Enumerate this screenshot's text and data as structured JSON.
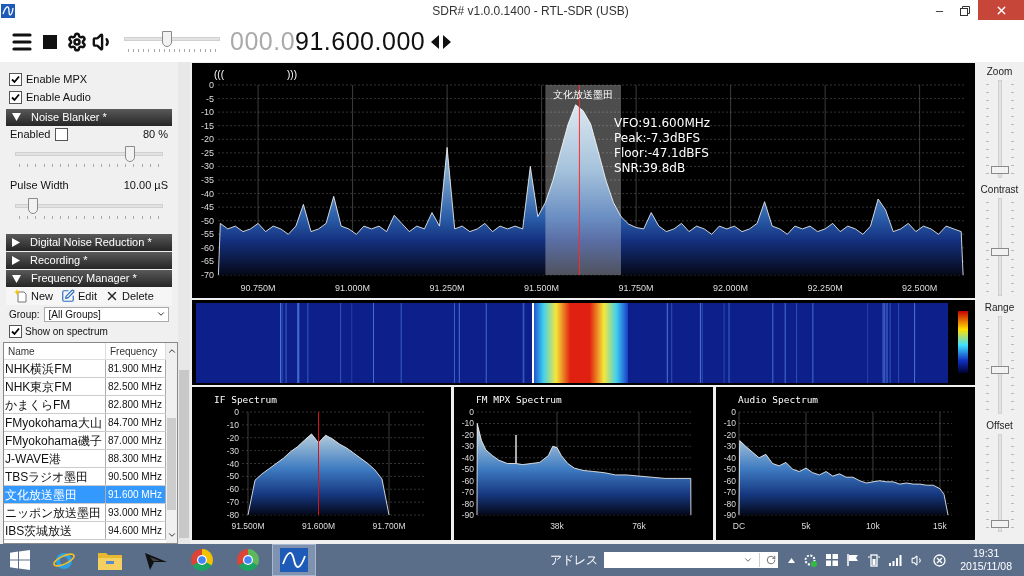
{
  "window": {
    "title": "SDR# v1.0.0.1400 - RTL-SDR (USB)"
  },
  "toolbar": {
    "volume": {
      "level": 0.45
    },
    "frequency": {
      "leading": "000.0",
      "value": "91.600.000"
    }
  },
  "left_panel": {
    "checkboxes": [
      {
        "label": "Enable MPX",
        "checked": true
      },
      {
        "label": "Enable Audio",
        "checked": true
      }
    ],
    "noise_blanker": {
      "header": "Noise Blanker *",
      "expanded": true,
      "enabled": {
        "label": "Enabled",
        "checked": false
      },
      "threshold": {
        "reading": "80 %",
        "level": 0.78
      },
      "pulse_width": {
        "label": "Pulse Width",
        "reading": "10.00 µS",
        "level": 0.12
      }
    },
    "sections": [
      {
        "header": "Digital Noise Reduction *",
        "expanded": false
      },
      {
        "header": "Recording *",
        "expanded": false
      }
    ],
    "frequency_manager": {
      "header": "Frequency Manager *",
      "expanded": true,
      "actions": [
        {
          "label": "New",
          "kind": "new"
        },
        {
          "label": "Edit",
          "kind": "edit"
        },
        {
          "label": "Delete",
          "kind": "delete"
        }
      ],
      "group": {
        "label": "Group:",
        "value": "[All Groups]"
      },
      "show_on_spectrum": {
        "label": "Show on spectrum",
        "checked": true
      },
      "table": {
        "columns": [
          "Name",
          "Frequency"
        ],
        "rows": [
          {
            "name": "NHK横浜FM",
            "frequency": "81.900 MHz",
            "selected": false
          },
          {
            "name": "NHK東京FM",
            "frequency": "82.500 MHz",
            "selected": false
          },
          {
            "name": "かまくらFM",
            "frequency": "82.800 MHz",
            "selected": false
          },
          {
            "name": "FMyokohama大山",
            "frequency": "84.700 MHz",
            "selected": false
          },
          {
            "name": "FMyokohama磯子",
            "frequency": "87.000 MHz",
            "selected": false
          },
          {
            "name": "J-WAVE港",
            "frequency": "88.300 MHz",
            "selected": false
          },
          {
            "name": "TBSラジオ墨田",
            "frequency": "90.500 MHz",
            "selected": false
          },
          {
            "name": "文化放送墨田",
            "frequency": "91.600 MHz",
            "selected": true
          },
          {
            "name": "ニッポン放送墨田",
            "frequency": "93.000 MHz",
            "selected": false
          },
          {
            "name": "IBS茨城放送",
            "frequency": "94.600 MHz",
            "selected": false
          }
        ]
      }
    }
  },
  "spectrum": {
    "scan_markers": [
      "(((",
      ")))"
    ],
    "readout": [
      "VFO:91.600MHz",
      "Peak:-7.3dBFS",
      "Floor:-47.1dBFS",
      "SNR:39.8dB"
    ],
    "chart_data": {
      "type": "area",
      "grid": true,
      "bands": [
        {
          "axis": "x",
          "from": 91.51,
          "to": 91.71,
          "label": "文化放送墨田"
        }
      ],
      "ref_lines": [
        {
          "axis": "x",
          "value": 91.6,
          "color": "#ff2a2a"
        }
      ],
      "xlim": [
        90.644,
        92.62
      ],
      "ylim": [
        -70,
        0
      ],
      "xticks": [
        {
          "value": 90.75,
          "label": "90.750M"
        },
        {
          "value": 91.0,
          "label": "91.000M"
        },
        {
          "value": 91.25,
          "label": "91.250M"
        },
        {
          "value": 91.5,
          "label": "91.500M"
        },
        {
          "value": 91.75,
          "label": "91.750M"
        },
        {
          "value": 92.0,
          "label": "92.000M"
        },
        {
          "value": 92.25,
          "label": "92.250M"
        },
        {
          "value": 92.5,
          "label": "92.500M"
        }
      ],
      "yticks": [
        0,
        -5,
        -10,
        -15,
        -20,
        -25,
        -30,
        -35,
        -40,
        -45,
        -50,
        -55,
        -60,
        -65,
        -70
      ],
      "x": [
        90.645,
        90.65,
        90.67,
        90.69,
        90.71,
        90.73,
        90.75,
        90.77,
        90.79,
        90.81,
        90.83,
        90.85,
        90.87,
        90.89,
        90.91,
        90.93,
        90.95,
        90.97,
        90.99,
        91.01,
        91.03,
        91.05,
        91.07,
        91.09,
        91.11,
        91.13,
        91.15,
        91.17,
        91.19,
        91.21,
        91.23,
        91.25,
        91.27,
        91.29,
        91.31,
        91.33,
        91.35,
        91.37,
        91.39,
        91.41,
        91.43,
        91.45,
        91.47,
        91.49,
        91.51,
        91.53,
        91.55,
        91.57,
        91.59,
        91.61,
        91.63,
        91.65,
        91.67,
        91.69,
        91.71,
        91.73,
        91.75,
        91.77,
        91.79,
        91.81,
        91.83,
        91.85,
        91.87,
        91.89,
        91.91,
        91.93,
        91.95,
        91.97,
        91.99,
        92.01,
        92.03,
        92.05,
        92.07,
        92.09,
        92.11,
        92.13,
        92.15,
        92.17,
        92.19,
        92.21,
        92.23,
        92.25,
        92.27,
        92.29,
        92.31,
        92.33,
        92.35,
        92.37,
        92.39,
        92.41,
        92.43,
        92.45,
        92.47,
        92.49,
        92.51,
        92.53,
        92.55,
        92.57,
        92.59,
        92.61,
        92.615
      ],
      "series": [
        {
          "color": "#ffffff",
          "values": [
            -70,
            -51,
            -53,
            -52,
            -54,
            -53,
            -51,
            -54,
            -52,
            -53,
            -55,
            -52,
            -44,
            -54,
            -53,
            -51,
            -41,
            -52,
            -53,
            -55,
            -52,
            -53,
            -52,
            -54,
            -48,
            -51,
            -54,
            -52,
            -53,
            -47,
            -52,
            -23,
            -53,
            -52,
            -54,
            -53,
            -51,
            -54,
            -52,
            -53,
            -52,
            -53,
            -30,
            -48.5,
            -43.3,
            -35.1,
            -24.6,
            -14.4,
            -7.3,
            -9.5,
            -14.4,
            -24.6,
            -35.1,
            -43.3,
            -48.5,
            -51.2,
            -52.5,
            -53,
            -47,
            -52,
            -54,
            -53,
            -51,
            -54,
            -52,
            -53,
            -55,
            -52,
            -53,
            -52,
            -54,
            -53,
            -51,
            -43,
            -52,
            -53,
            -55,
            -52,
            -53,
            -52,
            -54,
            -53,
            -51,
            -54,
            -52,
            -53,
            -55,
            -52,
            -42,
            -46,
            -54,
            -53,
            -51,
            -54,
            -52,
            -53,
            -55,
            -52,
            -53,
            -54,
            -70
          ]
        }
      ]
    }
  },
  "panels": [
    {
      "title": "IF Spectrum",
      "chart_data": {
        "type": "area",
        "grid": true,
        "ref_lines": [
          {
            "axis": "x",
            "value": 91.6,
            "color": "#e01010"
          }
        ],
        "xlim": [
          91.4915,
          91.7496
        ],
        "ylim": [
          -80,
          0
        ],
        "xticks": [
          {
            "value": 91.5,
            "label": "91.500M"
          },
          {
            "value": 91.6,
            "label": "91.600M"
          },
          {
            "value": 91.7,
            "label": "91.700M"
          }
        ],
        "yticks": [
          0,
          -10,
          -20,
          -30,
          -40,
          -50,
          -60,
          -70,
          -80
        ],
        "x": [
          91.5,
          91.51,
          91.52,
          91.53,
          91.54,
          91.55,
          91.56,
          91.57,
          91.58,
          91.59,
          91.6,
          91.61,
          91.62,
          91.63,
          91.64,
          91.65,
          91.66,
          91.67,
          91.68,
          91.69,
          91.7
        ],
        "series": [
          {
            "color": "#ffffff",
            "values": [
              -80,
              -53,
              -48,
              -44,
              -40,
              -36,
              -31,
              -27,
              -22,
              -17,
              -24,
              -18,
              -21,
              -25,
              -28,
              -32,
              -36,
              -40,
              -45,
              -52,
              -80
            ]
          }
        ]
      }
    },
    {
      "title": "FM MPX Spectrum",
      "chart_data": {
        "type": "area",
        "grid": true,
        "xlim": [
          0.93,
          100.1
        ],
        "ylim": [
          -90,
          0
        ],
        "xticks": [
          {
            "value": 38,
            "label": "38k"
          },
          {
            "value": 76,
            "label": "76k"
          }
        ],
        "yticks": [
          0,
          -10,
          -20,
          -30,
          -40,
          -50,
          -60,
          -70,
          -80,
          -90
        ],
        "x": [
          0.95,
          1,
          3,
          5,
          8,
          11,
          15,
          18.9,
          19,
          19.1,
          22,
          26,
          30,
          34,
          36,
          38,
          40,
          43,
          46,
          50,
          55,
          60,
          65,
          70,
          76,
          82,
          88,
          94,
          100,
          100.05
        ],
        "series": [
          {
            "color": "#ffffff",
            "values": [
              -90,
              -10,
              -25,
              -33,
              -38,
              -42,
              -45,
              -45,
              -20,
              -45,
              -46,
              -45,
              -44,
              -38,
              -30,
              -31,
              -38,
              -45,
              -49,
              -51,
              -52,
              -53,
              -55,
              -55,
              -56,
              -57,
              -58,
              -58,
              -58,
              -90
            ]
          }
        ]
      }
    },
    {
      "title": "Audio Spectrum",
      "chart_data": {
        "type": "area",
        "grid": true,
        "xlim": [
          0,
          15.9
        ],
        "ylim": [
          -90,
          0
        ],
        "xticks": [
          {
            "value": 0,
            "label": "DC"
          },
          {
            "value": 5,
            "label": "5k"
          },
          {
            "value": 10,
            "label": "10k"
          },
          {
            "value": 15,
            "label": "15k"
          }
        ],
        "yticks": [
          0,
          -10,
          -20,
          -30,
          -40,
          -50,
          -60,
          -70,
          -80,
          -90
        ],
        "x": [
          0,
          0.05,
          0.5,
          1,
          1.5,
          2,
          2.5,
          3,
          3.5,
          4,
          4.5,
          5,
          5.5,
          6,
          6.5,
          7,
          7.5,
          8,
          8.5,
          9,
          9.5,
          10,
          10.5,
          11,
          11.5,
          12,
          12.5,
          13,
          13.5,
          14,
          14.5,
          15,
          15.3,
          15.6
        ],
        "series": [
          {
            "color": "#ffffff",
            "values": [
              -90,
              -25,
              -30,
              -35,
              -40,
              -37,
              -45,
              -47,
              -44,
              -50,
              -52,
              -49,
              -53,
              -55,
              -52,
              -56,
              -54,
              -57,
              -57,
              -60,
              -62,
              -61,
              -60,
              -61,
              -61,
              -63,
              -62,
              -63,
              -63,
              -64,
              -64,
              -67,
              -72,
              -90
            ]
          }
        ]
      }
    }
  ],
  "side_sliders": [
    {
      "label": "Zoom",
      "level": 0.05
    },
    {
      "label": "Contrast",
      "level": 0.45
    },
    {
      "label": "Range",
      "level": 0.45
    },
    {
      "label": "Offset",
      "level": 0.05
    }
  ],
  "taskbar": {
    "apps": [
      {
        "kind": "ie",
        "selected": false
      },
      {
        "kind": "explorer",
        "selected": false
      },
      {
        "kind": "bird",
        "selected": false
      },
      {
        "kind": "chrome",
        "selected": false
      },
      {
        "kind": "chrome_alt",
        "selected": false
      },
      {
        "kind": "sdr",
        "selected": true
      }
    ],
    "address_label": "アドレス",
    "time": "19:31",
    "date": "2015/11/08"
  }
}
